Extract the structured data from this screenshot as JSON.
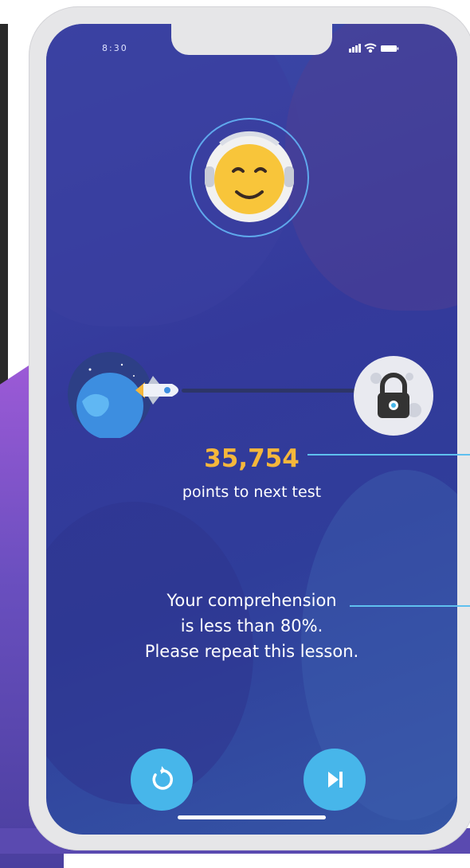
{
  "status_bar": {
    "time": "8:30"
  },
  "progress": {
    "points_value": "35,754",
    "points_label": "points to next test",
    "start_icon": "earth-planet-icon",
    "traveler_icon": "rocket-icon",
    "goal_icon": "locked-moon-icon"
  },
  "avatar": {
    "icon": "astronaut-smiling-face-icon"
  },
  "message": {
    "lines": [
      "Your comprehension",
      "is less than 80%.",
      "Please repeat this lesson."
    ]
  },
  "actions": {
    "repeat_icon": "repeat-arrow-icon",
    "next_icon": "skip-next-icon"
  },
  "colors": {
    "accent": "#47b6ea",
    "points": "#f5b73b",
    "background": "#34399b"
  }
}
